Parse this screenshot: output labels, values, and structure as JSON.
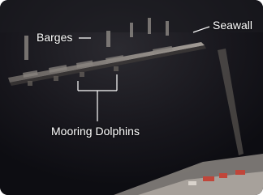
{
  "photo": {
    "subject": "aerial night photograph of a seawall with barges moored along it"
  },
  "labels": {
    "barges": "Barges",
    "seawall": "Seawall",
    "mooring_dolphins": "Mooring Dolphins"
  },
  "colors": {
    "label_text": "#ffffff",
    "callout_line": "#ffffff",
    "water": "#14141c"
  }
}
